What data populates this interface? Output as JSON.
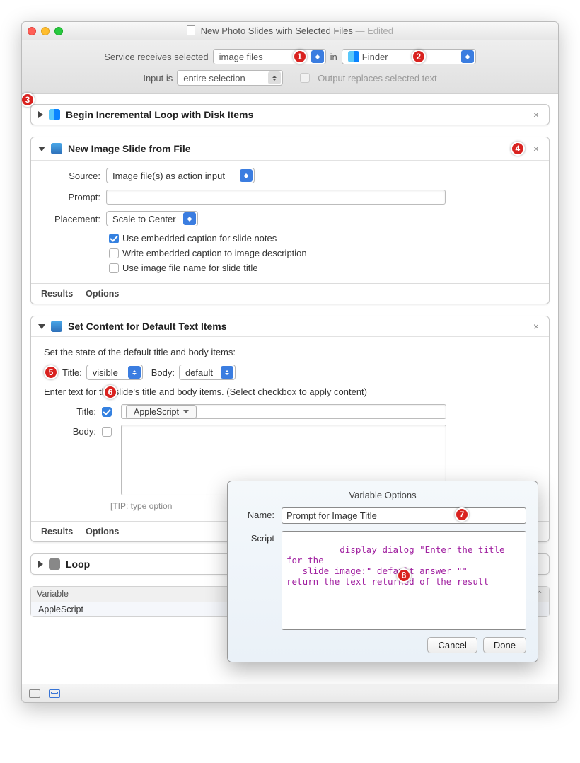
{
  "window": {
    "title": "New Photo Slides wirh Selected Files",
    "edited": "— Edited"
  },
  "toolbar": {
    "service_receives_label": "Service receives selected",
    "types_value": "image files",
    "in_label": "in",
    "app_value": "Finder",
    "input_is_label": "Input is",
    "input_is_value": "entire selection",
    "output_replaces_label": "Output replaces selected text"
  },
  "callouts": {
    "c1": "1",
    "c2": "2",
    "c3": "3",
    "c4": "4",
    "c5": "5",
    "c6": "6",
    "c7": "7",
    "c8": "8"
  },
  "action1": {
    "title": "Begin Incremental Loop with Disk Items"
  },
  "action2": {
    "title": "New Image Slide from File",
    "source_label": "Source:",
    "source_value": "Image file(s) as action input",
    "prompt_label": "Prompt:",
    "placement_label": "Placement:",
    "placement_value": "Scale to Center",
    "check1": "Use embedded caption for slide notes",
    "check2": "Write embedded caption to image description",
    "check3": "Use image file name for slide title",
    "results": "Results",
    "options": "Options"
  },
  "action3": {
    "title": "Set Content for Default Text Items",
    "desc1": "Set the state of the default title and body items:",
    "title_label": "Title:",
    "title_val": "visible",
    "body_label": "Body:",
    "body_val": "default",
    "desc2": "Enter text for the slide's title and body items. (Select checkbox to apply content)",
    "input_title_label": "Title:",
    "applescript_btn": "AppleScript",
    "input_body_label": "Body:",
    "tip": "[TIP: type option",
    "results": "Results",
    "options": "Options"
  },
  "action4": {
    "title": "Loop"
  },
  "variables": {
    "header": "Variable",
    "row1": "AppleScript"
  },
  "popover": {
    "header": "Variable Options",
    "name_label": "Name:",
    "name_value": "Prompt for Image Title",
    "script_label": "Script",
    "script_text": "display dialog \"Enter the title for the\n   slide image:\" default answer \"\"\nreturn the text returned of the result",
    "cancel": "Cancel",
    "done": "Done"
  }
}
